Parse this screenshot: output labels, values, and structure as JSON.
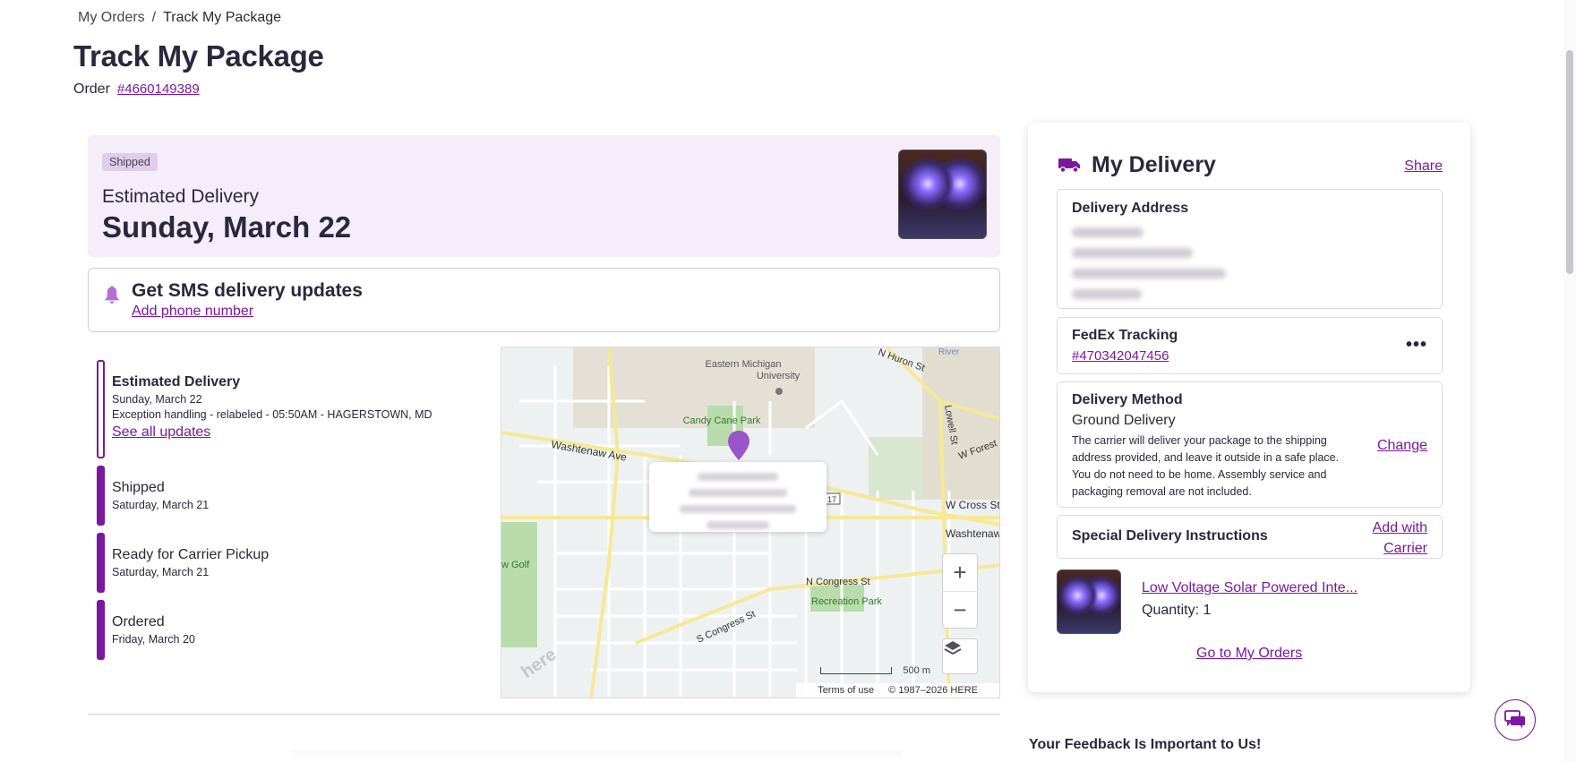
{
  "breadcrumb": {
    "parent": "My Orders",
    "separator": "/",
    "current": "Track My Package"
  },
  "page": {
    "title": "Track My Package",
    "order_label": "Order",
    "order_number": "#4660149389"
  },
  "status": {
    "badge": "Shipped",
    "est_label": "Estimated Delivery",
    "est_date": "Sunday, March 22"
  },
  "sms": {
    "title": "Get SMS delivery updates",
    "link": "Add phone number"
  },
  "timeline": [
    {
      "title": "Estimated Delivery",
      "date": "Sunday, March 22",
      "detail": "Exception handling - relabeled - 05:50AM - HAGERSTOWN, MD",
      "link": "See all updates"
    },
    {
      "title": "Shipped",
      "date": "Saturday, March 21"
    },
    {
      "title": "Ready for Carrier Pickup",
      "date": "Saturday, March 21"
    },
    {
      "title": "Ordered",
      "date": "Friday, March 20"
    }
  ],
  "map": {
    "labels": {
      "eastern_michigan": "Eastern Michigan",
      "university": "University",
      "candy_cane": "Candy Cane Park",
      "washtenaw": "Washtenaw Ave",
      "n_huron": "N Huron St",
      "lowell": "Lowell St",
      "w_forest": "W Forest",
      "w_cross": "W Cross St",
      "washtenaw_right": "Washtenaw",
      "route": "17",
      "n_congress": "N Congress St",
      "recreation": "Recreation Park",
      "s_congress": "S Congress St",
      "golf": "w Golf",
      "river": "River",
      "here_logo": "here"
    },
    "zoom_in": "+",
    "zoom_out": "−",
    "scale": "500 m",
    "terms": "Terms of use",
    "copyright": "© 1987–2026 HERE"
  },
  "delivery": {
    "title": "My Delivery",
    "share": "Share",
    "address_title": "Delivery Address",
    "tracking_title": "FedEx Tracking",
    "tracking_number": "#470342047456",
    "more": "•••",
    "method_title": "Delivery Method",
    "method_name": "Ground Delivery",
    "method_desc": "The carrier will deliver your package to the shipping address provided, and leave it outside in a safe place. You do not need to be home. Assembly service and packaging removal are not included.",
    "change": "Change",
    "special_title": "Special Delivery Instructions",
    "special_add_1": "Add with",
    "special_add_2": "Carrier",
    "item_name": "Low Voltage Solar Powered Inte...",
    "item_qty": "Quantity: 1",
    "go_orders": "Go to My Orders"
  },
  "feedback": "Your Feedback Is Important to Us!",
  "colors": {
    "accent": "#7b189f",
    "status_bg": "#f5eefa",
    "badge_bg": "#e0cceb",
    "text": "#2b273c"
  }
}
